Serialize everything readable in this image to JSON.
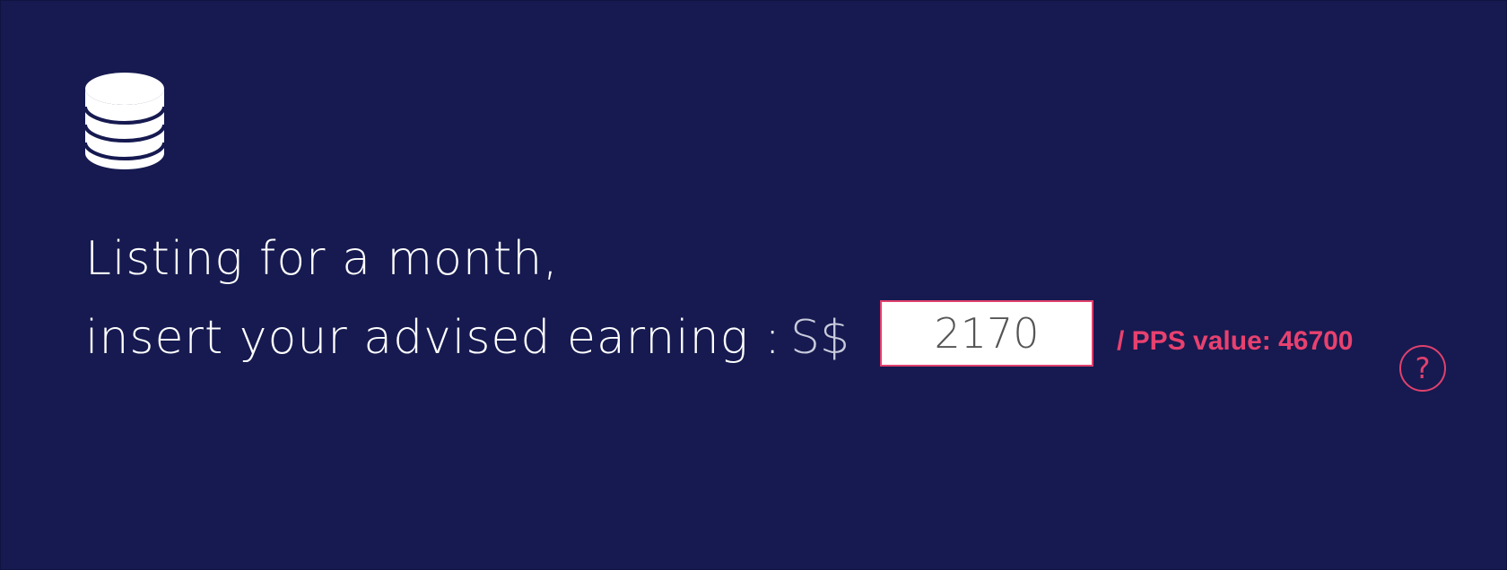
{
  "icon": "coins-stack-icon",
  "text": {
    "line1": "Listing for a month,",
    "line2": "insert your advised earning :",
    "currency": "S$"
  },
  "earning_input": {
    "value": "2170"
  },
  "pps_label": "/ PPS value: 46700",
  "help_icon": {
    "glyph": "?",
    "name": "help-icon"
  },
  "colors": {
    "background": "#161a50",
    "accent": "#e0416e",
    "text": "#ffffff"
  }
}
